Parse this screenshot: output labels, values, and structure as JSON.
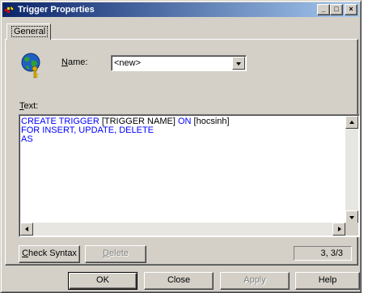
{
  "window": {
    "title": "Trigger Properties",
    "buttons": {
      "minimize": "_",
      "maximize": "□",
      "close": "×"
    }
  },
  "tabs": [
    {
      "label": "General",
      "selected": true
    }
  ],
  "general": {
    "icon": "globe-key-icon",
    "name_label_accel": "N",
    "name_label_rest": "ame:",
    "name_value": "<new>",
    "text_label_accel": "T",
    "text_label_rest": "ext:",
    "code_lines": [
      [
        {
          "t": "CREATE TRIGGER",
          "kw": true
        },
        {
          "t": " [TRIGGER NAME] ",
          "kw": false
        },
        {
          "t": "ON",
          "kw": true
        },
        {
          "t": " [hocsinh]",
          "kw": false
        }
      ],
      [
        {
          "t": "FOR INSERT, UPDATE, DELETE",
          "kw": true
        }
      ],
      [
        {
          "t": "AS",
          "kw": true
        }
      ]
    ],
    "check_syntax_accel": "C",
    "check_syntax_rest": "heck Syntax",
    "delete_accel": "D",
    "delete_rest": "elete",
    "cursor_position": "3, 3/3"
  },
  "footer": {
    "ok": "OK",
    "close": "Close",
    "apply": "Apply",
    "help": "Help"
  },
  "colors": {
    "title_start": "#0a246a",
    "title_end": "#a6caf0",
    "keyword": "#0000ff",
    "face": "#d4d0c8"
  }
}
